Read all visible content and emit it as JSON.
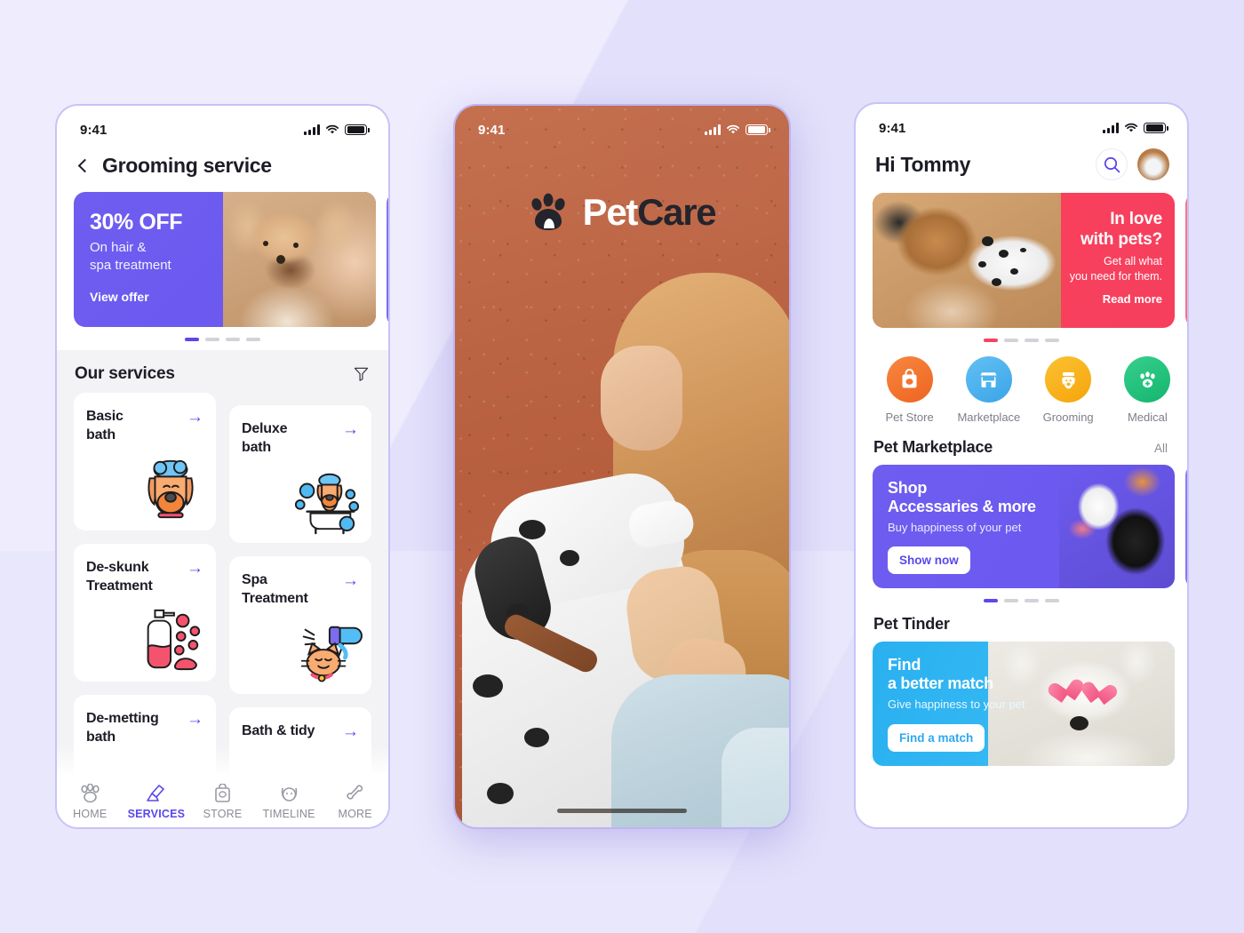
{
  "theme": {
    "purple": "#5a48ec",
    "red": "#f8405d",
    "blue": "#33b7f3",
    "page_bg": "#e6e4fb"
  },
  "status_bar": {
    "time": "9:41",
    "signal": "cellular-bars-icon",
    "wifi": "wifi-icon",
    "battery": "battery-icon"
  },
  "screen_grooming": {
    "back": "back-chevron-icon",
    "title": "Grooming service",
    "promo": {
      "headline": "30% OFF",
      "sub_line_1": "On hair &",
      "sub_line_2": "spa treatment",
      "cta": "View offer",
      "dots": {
        "count": 4,
        "active": 0
      }
    },
    "section": {
      "title": "Our services",
      "filter": "filter-funnel-icon"
    },
    "services_left": [
      {
        "label": "Basic\nbath",
        "arrow": "arrow-right-icon",
        "icon": "dog-shampoo-head-icon"
      },
      {
        "label": "De-skunk\nTreatment",
        "arrow": "arrow-right-icon",
        "icon": "shampoo-bottle-icon"
      },
      {
        "label": "De-metting\nbath",
        "arrow": "arrow-right-icon",
        "icon": "brush-icon"
      }
    ],
    "services_right": [
      {
        "label": "Deluxe\nbath",
        "arrow": "arrow-right-icon",
        "icon": "dog-in-bathtub-icon"
      },
      {
        "label": "Spa\nTreatment",
        "arrow": "arrow-right-icon",
        "icon": "cat-hairdryer-icon"
      },
      {
        "label": "Bath & tidy",
        "arrow": "arrow-right-icon",
        "icon": "bath-icon"
      }
    ],
    "tabs": [
      {
        "label": "HOME",
        "icon": "paw-icon",
        "active": false
      },
      {
        "label": "SERVICES",
        "icon": "grooming-brush-icon",
        "active": true
      },
      {
        "label": "STORE",
        "icon": "store-bag-icon",
        "active": false
      },
      {
        "label": "TIMELINE",
        "icon": "dog-face-icon",
        "active": false
      },
      {
        "label": "MORE",
        "icon": "bone-icon",
        "active": false
      }
    ]
  },
  "screen_splash": {
    "logo_mark": "paw-logo-icon",
    "logo_part_1": "Pet",
    "logo_part_2": "Care"
  },
  "screen_home": {
    "greeting": "Hi Tommy",
    "search": "search-icon",
    "avatar": "user-avatar",
    "hero": {
      "headline_1": "In love",
      "headline_2": "with pets?",
      "sub_1": "Get all what",
      "sub_2": "you need for them.",
      "cta": "Read more",
      "dots": {
        "count": 4,
        "active": 0
      }
    },
    "categories": [
      {
        "label": "Pet Store",
        "icon": "pet-store-bag-icon",
        "color": "#f2762e"
      },
      {
        "label": "Marketplace",
        "icon": "shop-front-icon",
        "color": "#4cb4ee"
      },
      {
        "label": "Grooming",
        "icon": "dog-grooming-icon",
        "color": "#f9b318"
      },
      {
        "label": "Medical",
        "icon": "paw-medical-icon",
        "color": "#23c47e"
      }
    ],
    "marketplace": {
      "section_title": "Pet Marketplace",
      "all": "All",
      "headline_1": "Shop",
      "headline_2": "Accessaries & more",
      "sub": "Buy happiness of your pet",
      "cta": "Show now",
      "dots": {
        "count": 4,
        "active": 0
      }
    },
    "tinder": {
      "section_title": "Pet Tinder",
      "headline_1": "Find",
      "headline_2": "a better match",
      "sub": "Give happiness to your pet",
      "cta": "Find a match"
    }
  }
}
